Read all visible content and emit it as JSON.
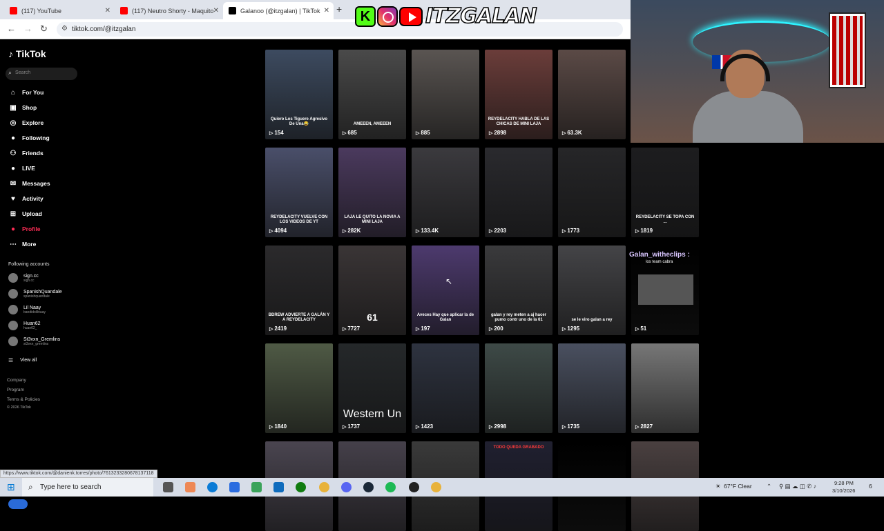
{
  "browser": {
    "tabs": [
      {
        "title": "(117) YouTube",
        "color": "#ff0000"
      },
      {
        "title": "(117) Neutro Shorty - Maquito",
        "color": "#ff0000"
      },
      {
        "title": "Galanoo (@itzgalan) | TikTok",
        "color": "#000000"
      }
    ],
    "url": "tiktok.com/@itzgalan",
    "status_url": "https://www.tiktok.com/@danienk.torres/photo/7613233280678137118"
  },
  "overlay": {
    "brand_text": "ITZGALAN",
    "kick_letter": "K"
  },
  "tiktok": {
    "logo": "TikTok",
    "search_placeholder": "Search",
    "nav": [
      {
        "label": "For You",
        "icon": "home-icon",
        "glyph": "⌂"
      },
      {
        "label": "Shop",
        "icon": "shop-icon",
        "glyph": "▣"
      },
      {
        "label": "Explore",
        "icon": "compass-icon",
        "glyph": "◎"
      },
      {
        "label": "Following",
        "icon": "avatar-icon",
        "glyph": "●"
      },
      {
        "label": "Friends",
        "icon": "friends-icon",
        "glyph": "⚇"
      },
      {
        "label": "LIVE",
        "icon": "live-icon",
        "glyph": "●"
      },
      {
        "label": "Messages",
        "icon": "messages-icon",
        "glyph": "✉"
      },
      {
        "label": "Activity",
        "icon": "activity-icon",
        "glyph": "♥"
      },
      {
        "label": "Upload",
        "icon": "upload-icon",
        "glyph": "⊞"
      },
      {
        "label": "Profile",
        "icon": "profile-icon",
        "glyph": "●"
      },
      {
        "label": "More",
        "icon": "more-icon",
        "glyph": "⋯"
      }
    ],
    "following_title": "Following accounts",
    "following": [
      {
        "name": "sign.cc",
        "handle": "sign.cc"
      },
      {
        "name": "SpanishQuandale",
        "handle": "spanishquandale"
      },
      {
        "name": "Lil Naay",
        "handle": "bandidolilnaay"
      },
      {
        "name": "Huan62",
        "handle": "huan62_"
      },
      {
        "name": "St3vxn_Gremlins",
        "handle": "st3vxn_gremlins"
      }
    ],
    "view_all": "View all",
    "footer": [
      "Company",
      "Program",
      "Terms & Policies",
      "© 2026 TikTok"
    ]
  },
  "videos": [
    {
      "views": "154",
      "caption": "Quiero Los Tiguere Agresivo De Una😂",
      "bg": "#3d4b60"
    },
    {
      "views": "685",
      "caption": "AMEEEN, AMEEEN",
      "bg": "#4a4a4a"
    },
    {
      "views": "885",
      "caption": "",
      "bg": "#5a5552"
    },
    {
      "views": "2898",
      "caption": "REYDELACITY HABLA DE LAS CHICAS DE MINI LAJA",
      "bg": "#6b3d3a"
    },
    {
      "views": "63.3K",
      "caption": "",
      "bg": "#5b4a46"
    },
    {
      "views": "4094",
      "caption": "REYDELACITY VUELVE CON LOS VIDEOS DE YT",
      "bg": "#4a4f6a"
    },
    {
      "views": "282K",
      "caption": "LAJA LE QUITO LA NOVIA A MINI LAJA",
      "bg": "#4b3a5e"
    },
    {
      "views": "133.4K",
      "caption": "",
      "bg": "#3b3a3e"
    },
    {
      "views": "2203",
      "caption": "",
      "bg": "#2a2a2e"
    },
    {
      "views": "1773",
      "caption": "",
      "bg": "#262628"
    },
    {
      "views": "1819",
      "caption": "REYDELACITY SE TOPA CON ...",
      "bg": "#1d1d1f"
    },
    {
      "views": "2419",
      "caption": "BDREW ADVIERTE A GALÁN Y A REYDELACITY",
      "bg": "#2b2a2c"
    },
    {
      "views": "7727",
      "caption": "61",
      "bg": "#3a3536"
    },
    {
      "views": "197",
      "caption": "Aveces Hay que aplicar la de Galan",
      "bg": "#4d3a6e"
    },
    {
      "views": "200",
      "caption": "galan y rey meten a aj hacer pumo contr uno de la 61",
      "bg": "#3a3a3c"
    },
    {
      "views": "1295",
      "caption": "se le viro galan a rey",
      "bg": "#444447"
    },
    {
      "views": "51",
      "caption": "",
      "bg": "#000000"
    },
    {
      "views": "1840",
      "caption": "",
      "bg": "#4f5a45"
    },
    {
      "views": "1737",
      "caption": "Western Un",
      "bg": "#25282a"
    },
    {
      "views": "1423",
      "caption": "",
      "bg": "#2e3340"
    },
    {
      "views": "2998",
      "caption": "",
      "bg": "#3e4a47"
    },
    {
      "views": "1735",
      "caption": "",
      "bg": "#4a5060"
    },
    {
      "views": "2827",
      "caption": "",
      "bg": "#777777"
    },
    {
      "views": "",
      "caption": "",
      "bg": "#4a4550"
    },
    {
      "views": "",
      "caption": "",
      "bg": "#45404a"
    },
    {
      "views": "",
      "caption": "",
      "bg": "#3a3a3a"
    },
    {
      "views": "",
      "caption": "TODO QUEDA GRABADO",
      "bg": "#202030"
    },
    {
      "views": "",
      "caption": "",
      "bg": "#000000"
    },
    {
      "views": "",
      "caption": "",
      "bg": "#4a4040"
    }
  ],
  "clip": {
    "label": "Galan_witheclips :",
    "sub": "los team cabra"
  },
  "taskbar": {
    "search_placeholder": "Type here to search",
    "weather": "67°F  Clear",
    "time": "9:28 PM",
    "date": "3/10/2026",
    "notif_count": "6"
  }
}
